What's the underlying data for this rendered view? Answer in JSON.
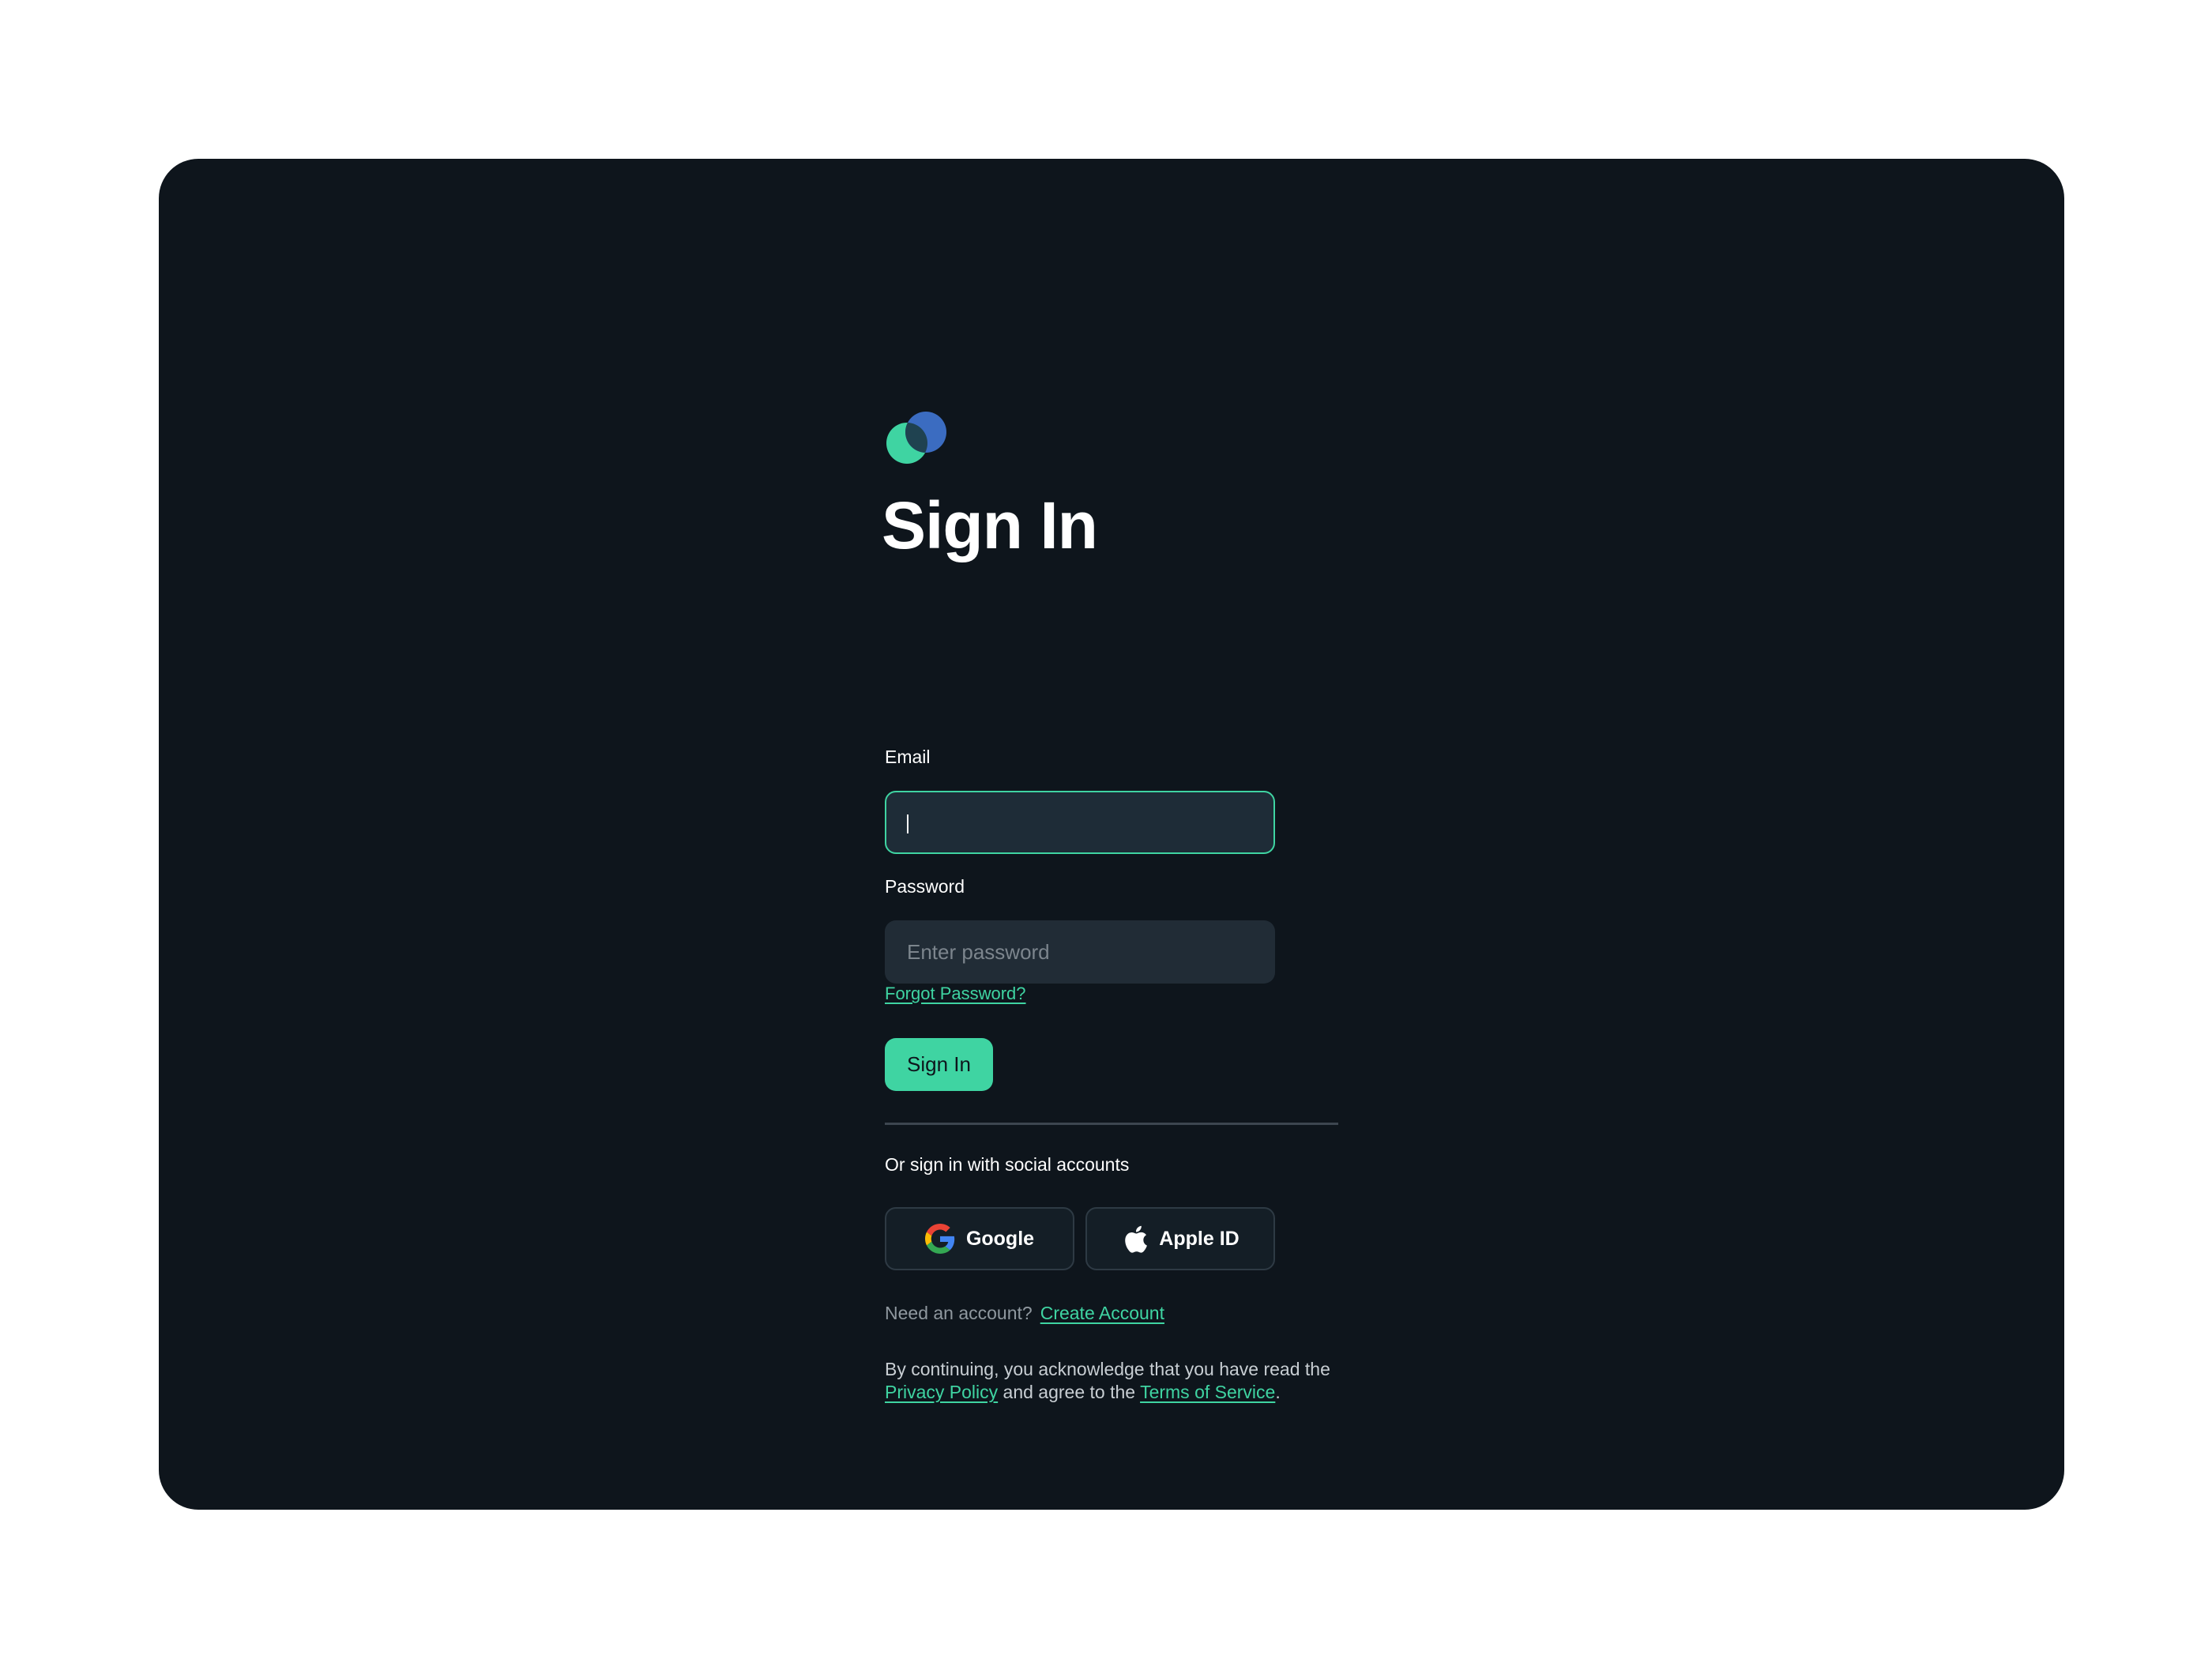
{
  "brand": {
    "logo_icon": "two-overlapping-circles-logo-icon",
    "colors": {
      "green": "#3fd4a2",
      "blue": "#3b6cc1",
      "overlap": "#1f4250"
    }
  },
  "page": {
    "title": "Sign In"
  },
  "email": {
    "label": "Email",
    "value": "",
    "placeholder": ""
  },
  "password": {
    "label": "Password",
    "value": "",
    "placeholder": "Enter password"
  },
  "forgot_password": "Forgot Password?",
  "sign_in_button": "Sign In",
  "social": {
    "label": "Or sign in with social accounts",
    "google": {
      "label": "Google",
      "icon": "google-g-icon"
    },
    "apple": {
      "label": "Apple ID",
      "icon": "apple-icon"
    }
  },
  "account": {
    "prompt": "Need an account?",
    "link": "Create Account"
  },
  "legal": {
    "prefix": "By continuing, you acknowledge that you have read the",
    "privacy_link": "Privacy Policy",
    "middle": "and agree to the",
    "terms_link": "Terms of Service",
    "suffix": "."
  },
  "theme": {
    "background": "#0e151c",
    "field_background": "#212c36",
    "accent": "#3fd4a2",
    "muted_text": "#8f989f"
  }
}
